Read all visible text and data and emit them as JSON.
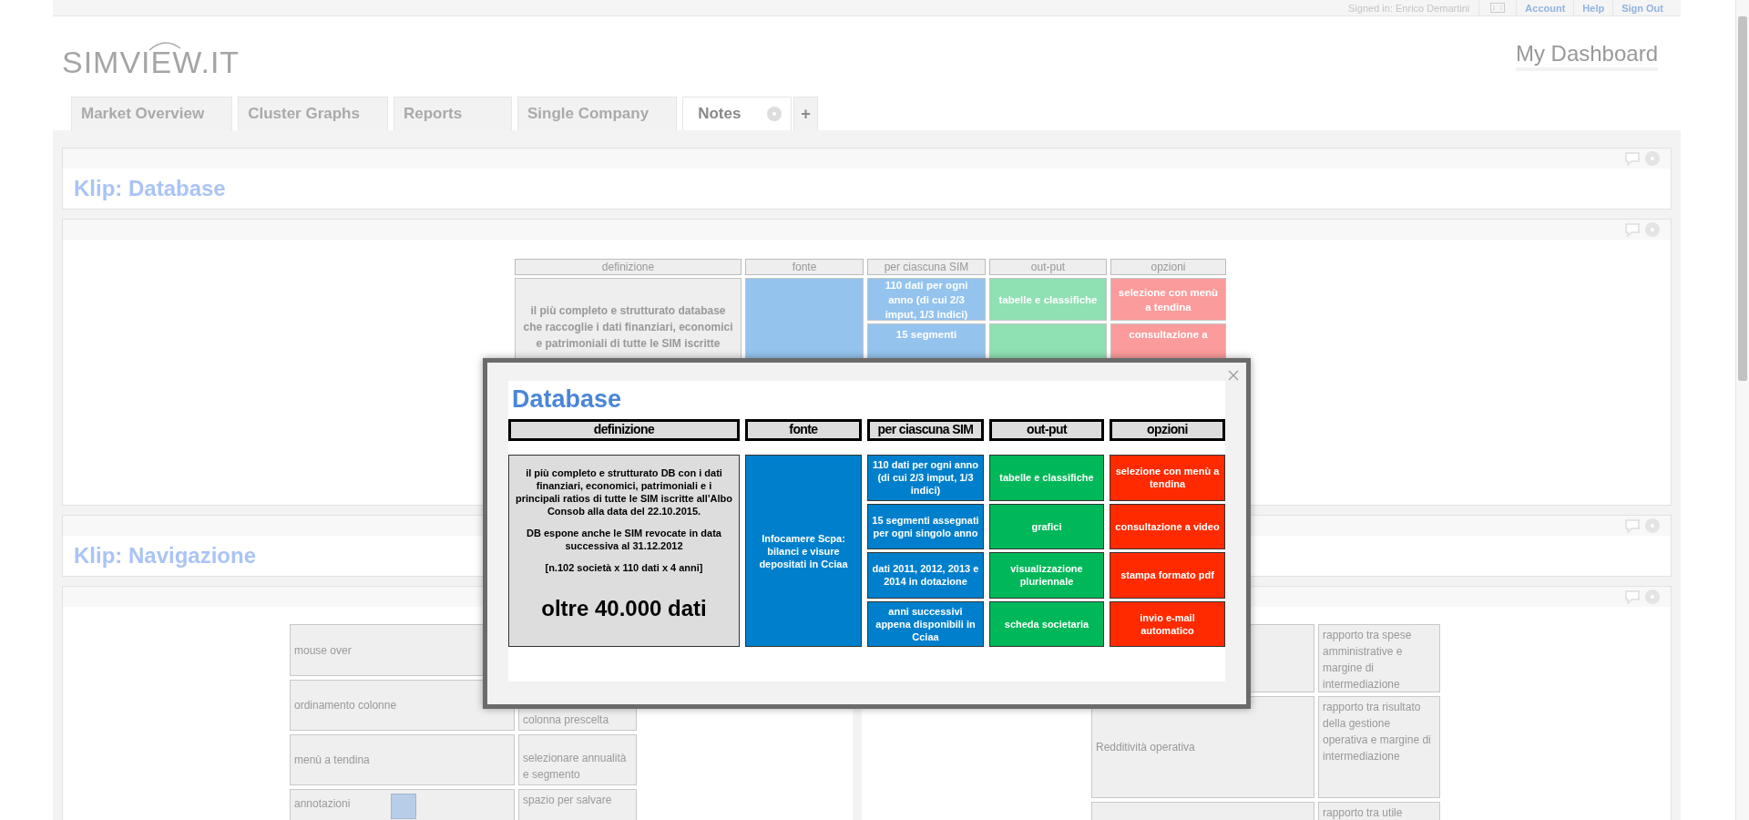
{
  "top_bar": {
    "signed_in": "Signed in: Enrico Demartini",
    "links": [
      "Account",
      "Help",
      "Sign Out"
    ]
  },
  "logo": "SIMVIEW.IT",
  "page_title": "My Dashboard",
  "tabs": [
    {
      "label": "Market Overview",
      "selected": false
    },
    {
      "label": "Cluster Graphs",
      "selected": false
    },
    {
      "label": "Reports",
      "selected": false
    },
    {
      "label": "Single Company",
      "selected": false
    },
    {
      "label": "Notes",
      "selected": true
    }
  ],
  "add_tab": {
    "label": "+"
  },
  "klip_database": {
    "title": "Klip: Database"
  },
  "database_table": {
    "columns": [
      {
        "header": "definizione",
        "cells": [
          {
            "text": "il più completo e strutturato database che raccoglie i dati finanziari, economici e patrimoniali di tutte le SIM iscritte",
            "color": "#eeeeee"
          }
        ]
      },
      {
        "header": "fonte",
        "cells": [
          {
            "color": "#94c3ee"
          }
        ]
      },
      {
        "header": "per ciascuna SIM",
        "cells": [
          {
            "text": "110 dati per ogni anno (di cui 2/3 imput, 1/3 indici)",
            "color": "#94c3ee"
          },
          {
            "text": "15 segmenti",
            "color": "#94c3ee"
          }
        ]
      },
      {
        "header": "out-put",
        "cells": [
          {
            "text": "tabelle e classifiche",
            "color": "#8fe0b3"
          },
          {
            "color": "#8fe0b3"
          }
        ]
      },
      {
        "header": "opzioni",
        "cells": [
          {
            "text": "selezione con menù a tendina",
            "color": "#fb9b9b"
          },
          {
            "text": "consultazione a",
            "color": "#fb9b9b"
          }
        ]
      }
    ]
  },
  "klip_navigazione": {
    "title": "Klip: Navigazione"
  },
  "navigation_tables": [
    {
      "rows": [
        {
          "kind": "text",
          "label": "mouse over"
        },
        {
          "kind": "text",
          "label": "ordinamento colonne",
          "description": "colonna prescelta"
        },
        {
          "kind": "text",
          "label": "menù a tendina",
          "description": "selezionare annualità e segmento"
        },
        {
          "kind": "note",
          "label": "annotazioni",
          "description": "spazio per salvare"
        }
      ]
    },
    {
      "rows": [
        {
          "kind": "text",
          "description": "rapporto tra spese amministrative e margine di intermediazione"
        },
        {
          "kind": "text",
          "label": "Redditività operativa",
          "description": "rapporto tra risultato della gestione operativa e margine di intermediazione"
        },
        {
          "kind": "text",
          "description": "rapporto tra utile"
        }
      ]
    }
  ],
  "modal": {
    "title": "Database",
    "columns": [
      {
        "header": "definizione",
        "cells": [
          {
            "color": "#dddddd",
            "paragraphs": [
              "il più completo e strutturato DB con i dati finanziari, economici, patrimoniali e i principali ratios di tutte le SIM iscritte all'Albo Consob alla data del 22.10.2015.",
              "DB espone anche le SIM revocate in data successiva al 31.12.2012",
              "[n.102 società x 110 dati x 4 anni]"
            ],
            "highlight": "oltre 40.000 dati"
          }
        ]
      },
      {
        "header": "fonte",
        "cells": [
          {
            "color": "#0080cc",
            "text": "Infocamere Scpa: bilanci e visure depositati in Cciaa"
          }
        ]
      },
      {
        "header": "per ciascuna SIM",
        "cells": [
          {
            "color": "#0080cc",
            "text": "110 dati per ogni anno (di cui 2/3 imput, 1/3 indici)"
          },
          {
            "color": "#0080cc",
            "text": "15 segmenti assegnati per ogni singolo anno"
          },
          {
            "color": "#0080cc",
            "text": "dati 2011, 2012, 2013 e 2014 in dotazione"
          },
          {
            "color": "#0080cc",
            "text": "anni successivi appena disponibili in Cciaa"
          }
        ]
      },
      {
        "header": "out-put",
        "cells": [
          {
            "color": "#00b859",
            "text": "tabelle e classifiche"
          },
          {
            "color": "#00b859",
            "text": "grafici"
          },
          {
            "color": "#00b859",
            "text": "visualizzazione pluriennale"
          },
          {
            "color": "#00b859",
            "text": "scheda societaria"
          }
        ]
      },
      {
        "header": "opzioni",
        "cells": [
          {
            "color": "#ff2a00",
            "text": "selezione con menù a tendina"
          },
          {
            "color": "#ff2a00",
            "text": "consultazione a video"
          },
          {
            "color": "#ff2a00",
            "text": "stampa formato pdf"
          },
          {
            "color": "#ff2a00",
            "text": "invio e-mail automatico"
          }
        ]
      }
    ]
  }
}
